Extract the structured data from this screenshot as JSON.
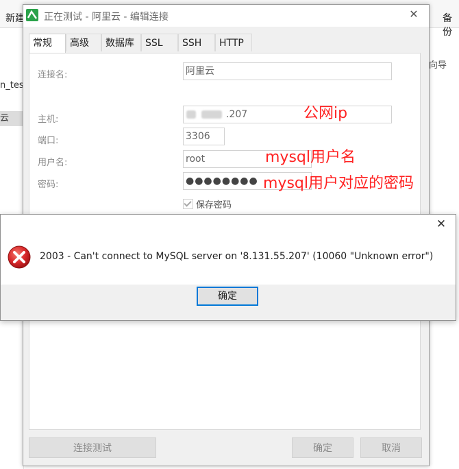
{
  "background": {
    "toolbar": {
      "new_label": "新建",
      "backup_label": "备份"
    },
    "sidebar": {
      "item_1": "n_tes",
      "item_2": "云"
    },
    "right_hint": "向导"
  },
  "dialog": {
    "title": "正在测试 - 阿里云 - 编辑连接",
    "tabs": [
      "常规",
      "高级",
      "数据库",
      "SSL",
      "SSH",
      "HTTP"
    ],
    "fields": {
      "conn_name": {
        "label": "连接名:",
        "value": "阿里云"
      },
      "host": {
        "label": "主机:",
        "value": ".207"
      },
      "port": {
        "label": "端口:",
        "value": "3306"
      },
      "username": {
        "label": "用户名:",
        "value": "root"
      },
      "password": {
        "label": "密码:",
        "value": "●●●●●●●●"
      }
    },
    "save_password": {
      "label": "保存密码",
      "checked": true
    },
    "annotations": {
      "host_note": "公网ip",
      "user_note": "mysql用户名",
      "password_note": "mysql用户对应的密码"
    },
    "buttons": {
      "test": "连接测试",
      "ok": "确定",
      "cancel": "取消"
    }
  },
  "error_dialog": {
    "message": "2003 - Can't connect to MySQL server on '8.131.55.207' (10060 \"Unknown error\")",
    "ok_label": "确定"
  },
  "colors": {
    "annotation": "#ff2222",
    "error_red": "#d9292b",
    "focus_blue": "#0078d7",
    "logo_green": "#2aa24a"
  }
}
